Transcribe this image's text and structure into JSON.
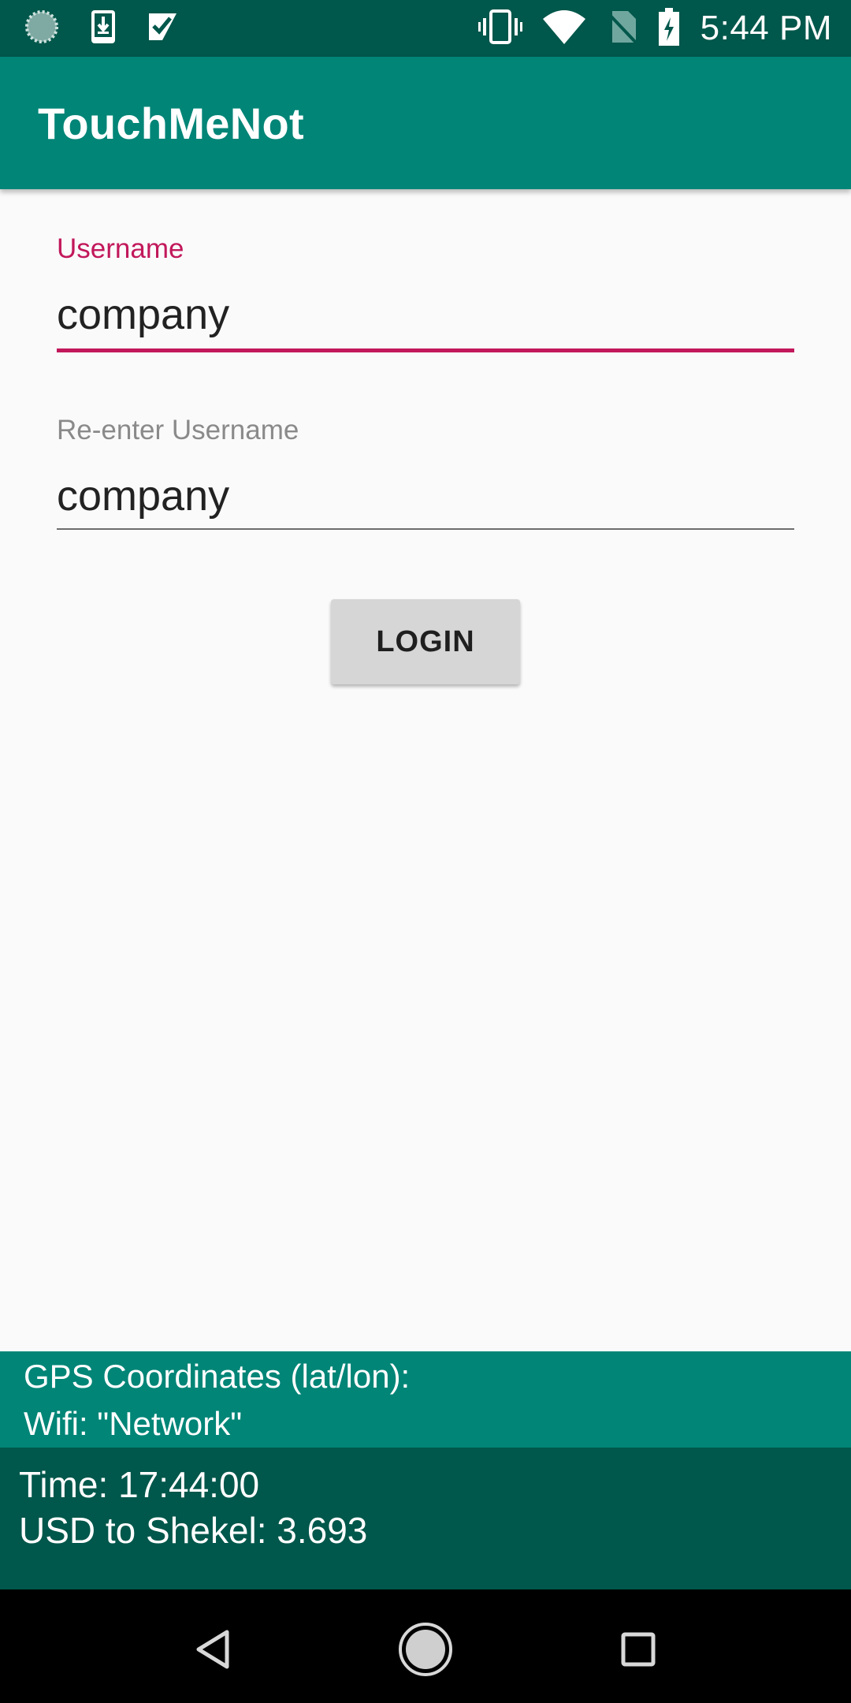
{
  "status_bar": {
    "time": "5:44 PM",
    "left_icons": [
      "loading-indicator-icon",
      "download-icon",
      "checklist-icon"
    ],
    "right_icons": [
      "vibrate-icon",
      "wifi-icon",
      "no-sim-icon",
      "battery-charging-icon"
    ]
  },
  "app_bar": {
    "title": "TouchMeNot"
  },
  "form": {
    "username_label": "Username",
    "username_value": "company",
    "reenter_label": "Re-enter Username",
    "reenter_value": "company",
    "login_label": "LOGIN"
  },
  "info": {
    "gps": "GPS Coordinates (lat/lon):",
    "wifi": "Wifi: \"Network\"",
    "time": "Time: 17:44:00",
    "rate": "USD to Shekel: 3.693"
  },
  "colors": {
    "primary": "#008577",
    "primary_dark": "#00574b",
    "accent": "#c2185b"
  }
}
